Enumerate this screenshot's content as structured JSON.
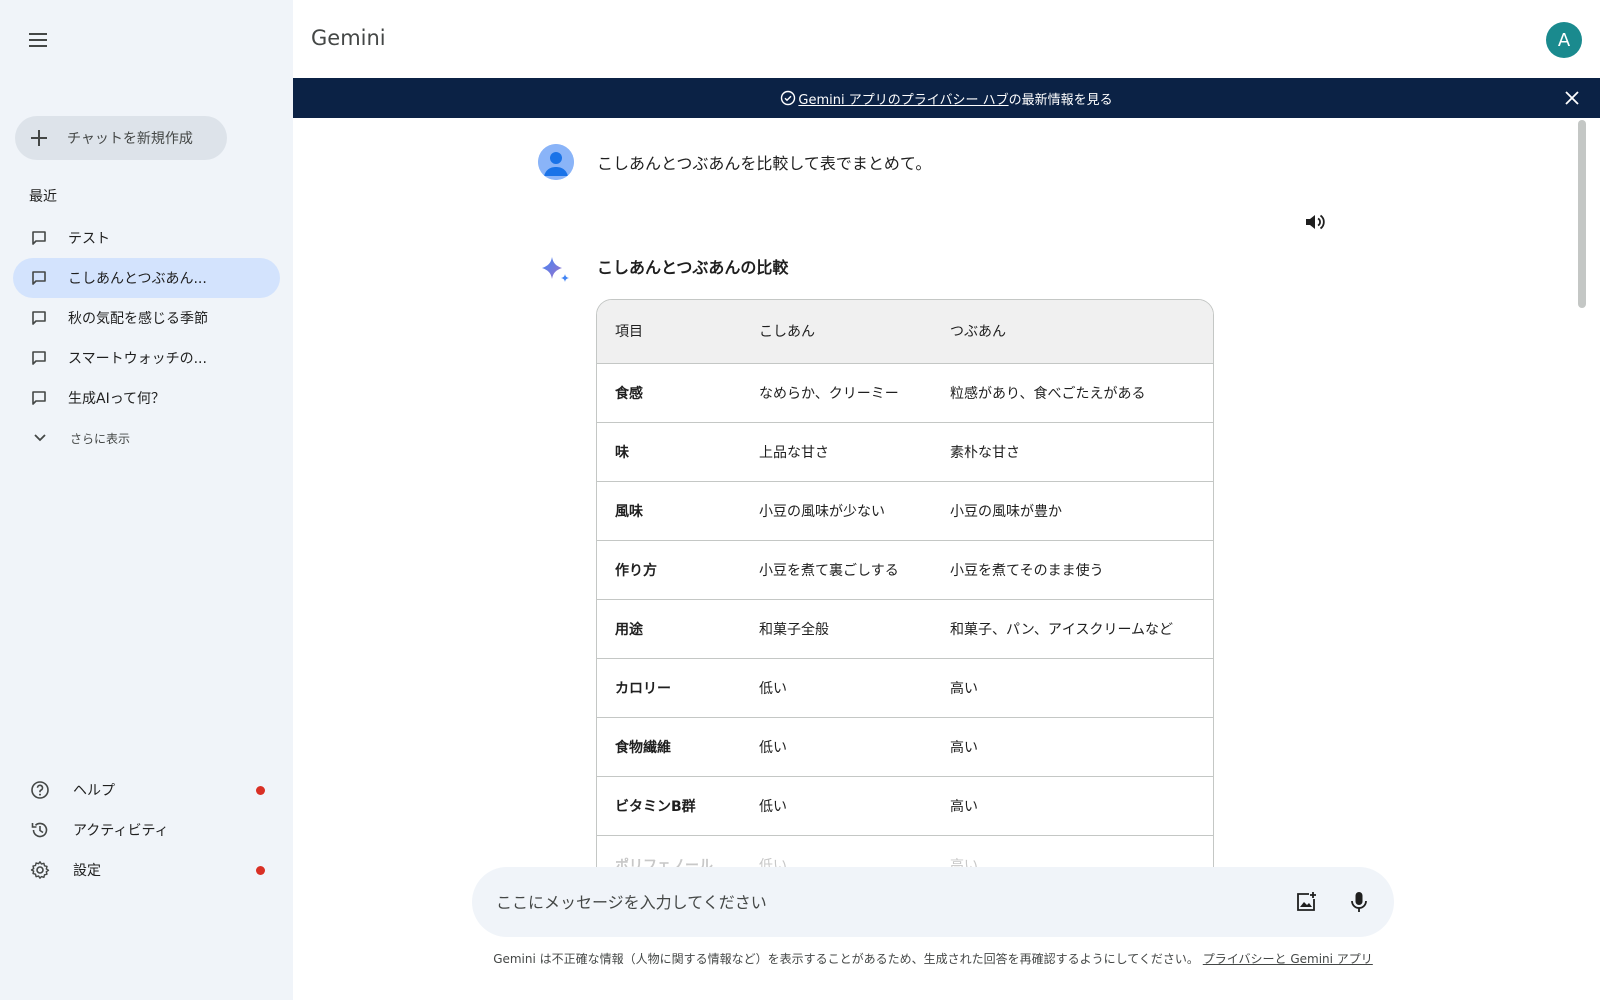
{
  "app": {
    "title": "Gemini",
    "avatar_letter": "A"
  },
  "sidebar": {
    "menu_icon": "hamburger-menu-icon",
    "new_chat_label": "チャットを新規作成",
    "recent_title": "最近",
    "recent_items": [
      {
        "label": "テスト",
        "active": false
      },
      {
        "label": "こしあんとつぶあん...",
        "active": true
      },
      {
        "label": "秋の気配を感じる季節",
        "active": false
      },
      {
        "label": "スマートウォッチの...",
        "active": false
      },
      {
        "label": "生成AIって何？",
        "active": false
      }
    ],
    "show_more_label": "さらに表示",
    "bottom_items": [
      {
        "label": "ヘルプ",
        "icon": "help-icon",
        "dot": true
      },
      {
        "label": "アクティビティ",
        "icon": "history-icon",
        "dot": false
      },
      {
        "label": "設定",
        "icon": "gear-icon",
        "dot": true
      }
    ],
    "dot_color": "#d93025"
  },
  "banner": {
    "link_text": "Gemini アプリのプライバシー ハブ",
    "suffix_text": "の最新情報を見る"
  },
  "chat": {
    "user_message": "こしあんとつぶあんを比較して表でまとめて。",
    "response_title": "こしあんとつぶあんの比較",
    "table": {
      "headers": [
        "項目",
        "こしあん",
        "つぶあん"
      ],
      "rows": [
        [
          "食感",
          "なめらか、クリーミー",
          "粒感があり、食べごたえがある"
        ],
        [
          "味",
          "上品な甘さ",
          "素朴な甘さ"
        ],
        [
          "風味",
          "小豆の風味が少ない",
          "小豆の風味が豊か"
        ],
        [
          "作り方",
          "小豆を煮て裏ごしする",
          "小豆を煮てそのまま使う"
        ],
        [
          "用途",
          "和菓子全般",
          "和菓子、パン、アイスクリームなど"
        ],
        [
          "カロリー",
          "低い",
          "高い"
        ],
        [
          "食物繊維",
          "低い",
          "高い"
        ],
        [
          "ビタミンB群",
          "低い",
          "高い"
        ],
        [
          "ポリフェノール",
          "低い",
          "高い"
        ]
      ]
    }
  },
  "input": {
    "placeholder": "ここにメッセージを入力してください",
    "value": ""
  },
  "disclaimer": {
    "text": "Gemini は不正確な情報（人物に関する情報など）を表示することがあるため、生成された回答を再確認するようにしてください。",
    "link": "プライバシーと Gemini アプリ"
  },
  "colors": {
    "sidebar_bg": "#f0f4f9",
    "active_item_bg": "#d3e3fd",
    "banner_bg": "#0b2245",
    "avatar_bg": "#1a8a8e"
  }
}
